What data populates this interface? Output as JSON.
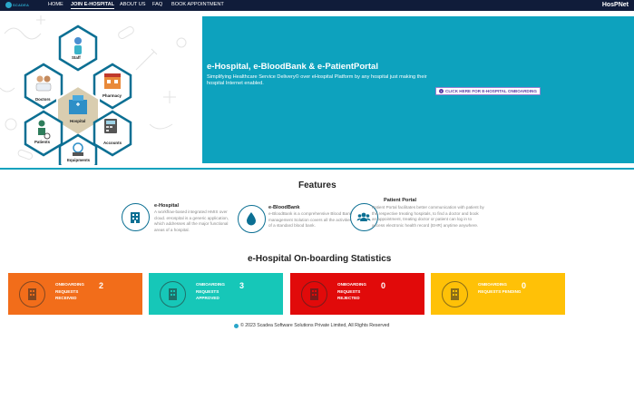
{
  "navbar": {
    "logo_text": "SCADEA",
    "links": [
      {
        "label": "HOME",
        "active": false
      },
      {
        "label": "JOIN E-HOSPITAL",
        "active": true
      },
      {
        "label": "ABOUT US",
        "active": false
      },
      {
        "label": "FAQ",
        "active": false
      },
      {
        "label": "BOOK APPOINTMENT",
        "active": false
      }
    ],
    "brand": "HosPNet"
  },
  "hero": {
    "hex_labels": {
      "staff": "Staff",
      "doctors": "Doctors",
      "pharmacy": "Pharmacy",
      "hospital": "Hospital",
      "patients": "Patients",
      "accounts": "Accounts",
      "equipments": "Equipments"
    },
    "title": "e-Hospital, e-BloodBank & e-PatientPortal",
    "description": "Simplifying Healthcare Service Delivery© over eHospital Platform by any hospital just making their hospital Internet enabled.",
    "cta_label": "CLICK HERE FOR E-HOSPITAL ONBOARDING",
    "colors": {
      "panel": "#0da2be",
      "hex_border": "#0b6f93"
    }
  },
  "features": {
    "title": "Features",
    "items": [
      {
        "title": "e-Hospital",
        "description": "A workflow-based integrated HMIS over cloud. eHospital is a generic application, which addresses all the major functional areas of a hospital.",
        "icon": "hospital-building-icon"
      },
      {
        "title": "e-BloodBank",
        "description": "e-BloodBank is a comprehensive Blood Bank management Solution covers all the activities of a standard blood bank.",
        "icon": "blood-drop-icon"
      },
      {
        "title": "Patient Portal",
        "description": "Patient Portal facilitates better communication with patient by the respective treating hospitals, to find a doctor and book an appointment, treating doctor or patient can log in to access electronic health record (EHR) anytime anywhere.",
        "icon": "users-group-icon"
      }
    ]
  },
  "stats": {
    "title": "e-Hospital On-boarding Statistics",
    "cards": [
      {
        "label": "ONBOARDING REQUESTS RECEIVED",
        "value": "2",
        "color": "#f26d1a"
      },
      {
        "label": "ONBOARDING REQUESTS APPROVED",
        "value": "3",
        "color": "#16c7b8"
      },
      {
        "label": "ONBOARDING REQUESTS REJECTED",
        "value": "0",
        "color": "#e10a0a"
      },
      {
        "label": "ONBOARDING REQUESTS PENDING",
        "value": "0",
        "color": "#ffc107"
      }
    ]
  },
  "footer": {
    "text": "© 2023 Scadea Software Solutions Private Limited, All Rights Reserved"
  }
}
